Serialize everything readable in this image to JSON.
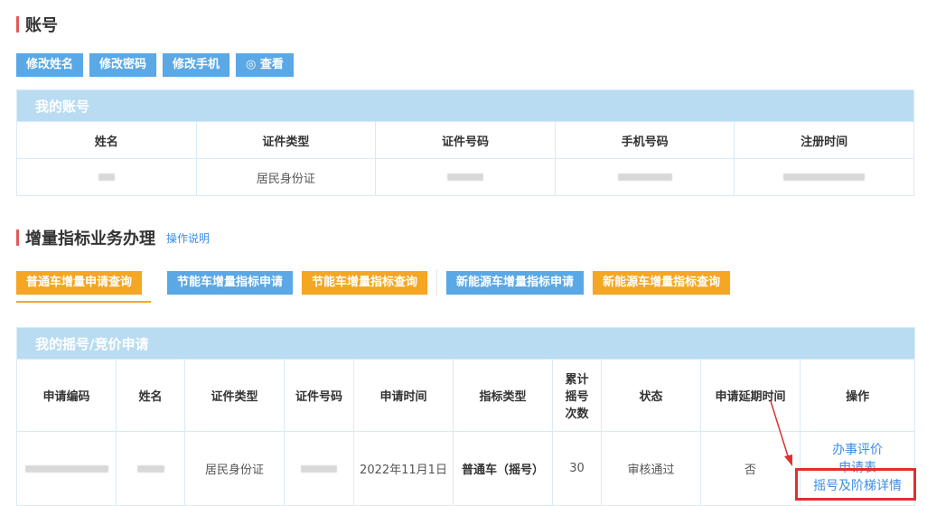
{
  "account": {
    "title": "账号",
    "buttons": [
      {
        "label": "修改姓名",
        "icon": ""
      },
      {
        "label": "修改密码",
        "icon": ""
      },
      {
        "label": "修改手机",
        "icon": ""
      },
      {
        "label": "查看",
        "icon": "eye-icon"
      }
    ],
    "table_caption": "我的账号",
    "columns": [
      "姓名",
      "证件类型",
      "证件号码",
      "手机号码",
      "注册时间"
    ],
    "row": {
      "name": "",
      "id_type": "居民身份证",
      "id_number": "",
      "phone": "",
      "reg_time": ""
    }
  },
  "business": {
    "title": "增量指标业务办理",
    "help_link": "操作说明",
    "buttons": [
      {
        "label": "普通车增量申请查询",
        "color": "#f5a623"
      },
      {
        "label": "节能车增量指标申请",
        "color": "#5aa8e6"
      },
      {
        "label": "节能车增量指标查询",
        "color": "#f5a623"
      },
      {
        "label": "新能源车增量指标申请",
        "color": "#5aa8e6"
      },
      {
        "label": "新能源车增量指标查询",
        "color": "#f5a623"
      }
    ],
    "table_caption": "我的摇号/竞价申请",
    "columns": [
      "申请编码",
      "姓名",
      "证件类型",
      "证件号码",
      "申请时间",
      "指标类型",
      "累计摇号次数",
      "状态",
      "申请延期时间",
      "操作"
    ],
    "row": {
      "code": "",
      "name": "",
      "id_type": "居民身份证",
      "id_number": "",
      "apply_time": "2022年11月1日",
      "index_type": "普通车（摇号）",
      "count": "30",
      "status": "审核通过",
      "delay": "否",
      "actions": [
        "办事评价",
        "申请表",
        "摇号及阶梯详情"
      ]
    }
  },
  "colors": {
    "accent_blue": "#5aa8e6",
    "accent_orange": "#f5a623",
    "table_header": "#b9dcf2",
    "highlight_red": "#e02f2f"
  }
}
